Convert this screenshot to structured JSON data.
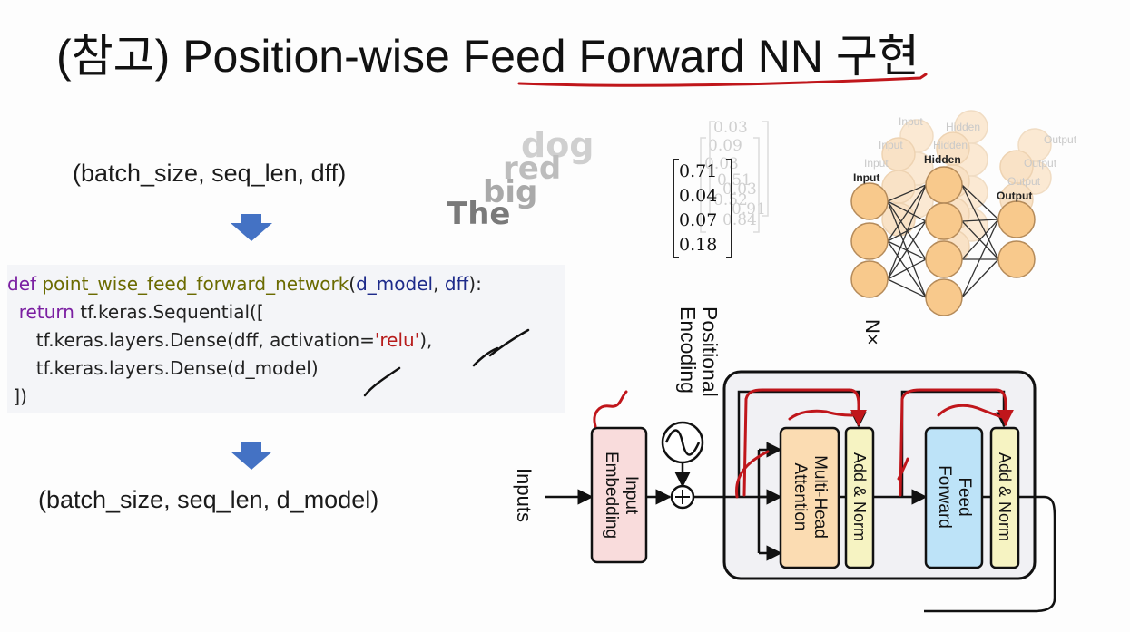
{
  "slide": {
    "title": "(참고) Position-wise Feed Forward NN 구현",
    "input_shape": "(batch_size, seq_len, dff)",
    "output_shape": "(batch_size, seq_len, d_model)",
    "code": {
      "line1_kw": "def",
      "line1_fn": "point_wise_feed_forward_network",
      "line1_open": "(",
      "line1_arg1": "d_model",
      "line1_sep": ", ",
      "line1_arg2": "dff",
      "line1_close": "):",
      "line2_kw": "return",
      "line2_rest": " tf.keras.Sequential([",
      "line3_pre": "tf.keras.layers.Dense(dff, activation=",
      "line3_str": "'relu'",
      "line3_post": "),",
      "line4": "tf.keras.layers.Dense(d_model)",
      "line5": "])"
    },
    "embedding_words": [
      "dog",
      "red",
      "big",
      "The"
    ],
    "vector_values": [
      "0.71",
      "0.04",
      "0.07",
      "0.18"
    ],
    "vector_ghost_values": [
      "0.03",
      "0.09",
      "0.03",
      "0.51",
      "0.03",
      "0.52",
      "0.91",
      "0.84"
    ],
    "nn_labels": {
      "input": "Input",
      "hidden": "Hidden",
      "output": "Output"
    },
    "transformer": {
      "positional_encoding": "Positional\nEncoding",
      "inputs": "Inputs",
      "input_embedding": "Input\nEmbedding",
      "multi_head_attention": "Multi-Head\nAttention",
      "add_norm": "Add & Norm",
      "feed_forward": "Feed\nForward",
      "nx": "N×"
    },
    "colors": {
      "annotation_red": "#c0161b",
      "arrow_blue": "#4472c4",
      "embedding_fill": "#f9dcdc",
      "attention_fill": "#fbdcb2",
      "addnorm_fill": "#f6f3c2",
      "ff_fill": "#bde3f8",
      "neuron_fill": "#f8c98c"
    }
  }
}
